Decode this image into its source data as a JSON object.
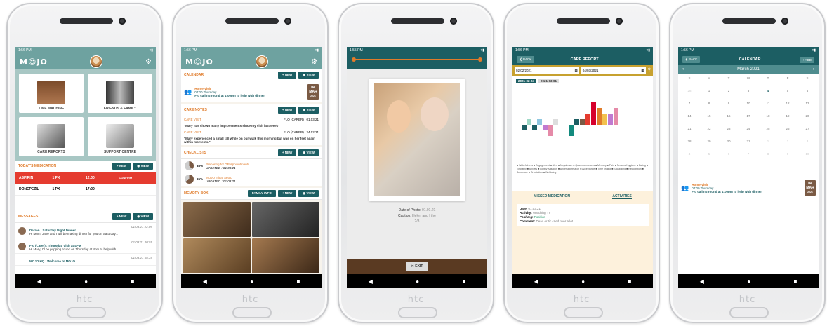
{
  "device_brand": "htc",
  "phone1": {
    "status_time": "1:56 PM",
    "app_name": "M☺JO",
    "tiles": [
      "TIME MACHINE",
      "FRIENDS & FAMILY",
      "CARE REPORTS",
      "SUPPORT CENTRE"
    ],
    "meds_title": "TODAY'S MEDICATION",
    "new_label": "NEW",
    "view_label": "VIEW",
    "meds": [
      {
        "name": "ASPIRIN",
        "dose": "1 PX",
        "time": "12:00",
        "status": "CONFIRM"
      },
      {
        "name": "DONEPEZIL",
        "dose": "1 PX",
        "time": "17:00",
        "status": ""
      }
    ],
    "messages_title": "MESSAGES",
    "messages": [
      {
        "date": "01.03.21 22:05",
        "from": "Darren",
        "subject": "Saturday Night Dinner",
        "preview": "Hi Mum, Jane and I will be making dinner for you on Saturday..."
      },
      {
        "date": "01.03.21 20:59",
        "from": "Flo (Carer)",
        "subject": "Thursday Visit at 4PM",
        "preview": "Hi Mary, I'll be popping round on Thursday at 4pm to help with..."
      },
      {
        "date": "01.03.21 18:39",
        "from": "MOJO HQ",
        "subject": "Welcome to MOJO",
        "preview": ""
      }
    ]
  },
  "phone2": {
    "status_time": "1:56 PM",
    "app_name": "M☺JO",
    "calendar_title": "CALENDAR",
    "new_label": "NEW",
    "view_label": "VIEW",
    "event": {
      "title": "Home Visit",
      "time": "04:00 Thursday",
      "desc": "Flo calling round at 4:00pm to help with dinner",
      "day": "04",
      "month": "MAR",
      "year": "2021"
    },
    "care_notes_title": "CARE NOTES",
    "notes": [
      {
        "title": "CARE VISIT",
        "by": "FLO (CARER) , 01.03.21",
        "text": "\"Mary has shown many improvements since my visit last week\""
      },
      {
        "title": "CARE VISIT",
        "by": "FLO (CARER) , 24.02.21",
        "text": "\"Mary experienced a small fall while on our walk this morning but was on her feet again within moments.\""
      }
    ],
    "checklists_title": "CHECKLISTS",
    "checklists": [
      {
        "pct": "38%",
        "title": "Preparing for GP Appointments",
        "updated": "UPDATED : 01.03.21"
      },
      {
        "pct": "65%",
        "title": "MOJO Initial Setup",
        "updated": "UPDATED : 01.03.21"
      }
    ],
    "memory_title": "MEMORY BOX",
    "family_info_label": "FAMILY INFO"
  },
  "phone3": {
    "status_time": "1:55 PM",
    "date_label": "Date of Photo:",
    "date_value": "01.01.21",
    "caption_label": "Caption:",
    "caption_value": "Helen and I the",
    "counter": "2/3",
    "exit_label": "EXIT"
  },
  "phone4": {
    "status_time": "1:56 PM",
    "back_label": "BACK",
    "title": "CARE REPORT",
    "from_date": "02/02/2021",
    "to_date": "04/03/2021",
    "chips": [
      "2021-02-24",
      "2021-03-01"
    ],
    "legend": "■ Wakefulness ■ Engagement ■ Alert ■ Negativism ■ Quarrelsomeness ■ Memory ■ Pain ■ Personal hygiene ■ Eating ■ Empathy ■ Anxiety ■ Lonely Agitation ■ Anger/aggression ■ Acceptance ■ Time finding ■ Socializing ■ Recognition ■ Behaviour ■ Orientation ■ Wellbeing",
    "tab_missed": "MISSED MEDICATION",
    "tab_activities": "ACTIVITIES",
    "activity": {
      "date_label": "Date:",
      "date": "01.03.21",
      "activity_label": "Activity:",
      "activity": "Watching TV",
      "pos_label": "Pos/Neg:",
      "pos": "Positive",
      "comment_label": "Comment:",
      "comment": "Dead or tic cried over a lot"
    }
  },
  "phone5": {
    "status_time": "1:56 PM",
    "back_label": "BACK",
    "title": "CALENDAR",
    "add_label": "ADD",
    "month": "March 2021",
    "weekdays": [
      "S",
      "M",
      "T",
      "W",
      "T",
      "F",
      "S"
    ],
    "days": [
      "28",
      "1",
      "2",
      "3",
      "4",
      "5",
      "6",
      "7",
      "8",
      "9",
      "10",
      "11",
      "12",
      "13",
      "14",
      "15",
      "16",
      "17",
      "18",
      "19",
      "20",
      "21",
      "22",
      "23",
      "24",
      "25",
      "26",
      "27",
      "28",
      "29",
      "30",
      "31",
      "1",
      "2",
      "3",
      "4",
      "5",
      "6",
      "7",
      "8",
      "9",
      "10"
    ],
    "event": {
      "title": "Home Visit",
      "time": "04:00 Thursday",
      "desc": "Flo calling round at 4:00pm to help with dinner",
      "day": "04",
      "month": "MAR",
      "year": "2021"
    }
  }
}
